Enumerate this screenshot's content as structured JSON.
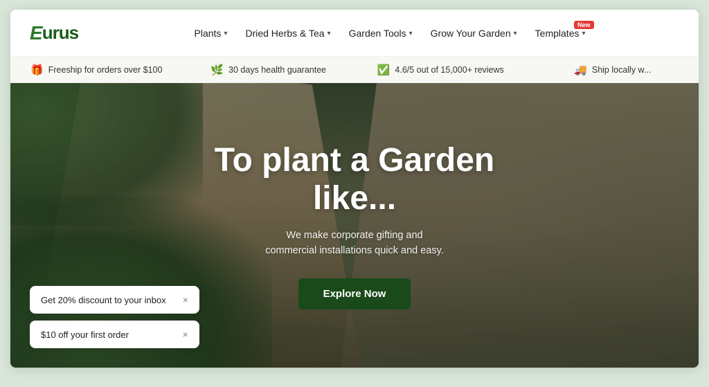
{
  "brand": {
    "name": "Eurus",
    "logo_e": "E",
    "logo_rest": "urus"
  },
  "nav": {
    "items": [
      {
        "label": "Plants",
        "has_dropdown": true
      },
      {
        "label": "Dried Herbs & Tea",
        "has_dropdown": true
      },
      {
        "label": "Garden Tools",
        "has_dropdown": true
      },
      {
        "label": "Grow Your Garden",
        "has_dropdown": true
      },
      {
        "label": "Templates",
        "has_dropdown": true,
        "badge": "New"
      }
    ]
  },
  "promo_bar": {
    "items": [
      {
        "icon": "🎁",
        "text": "Freeship for orders over $100"
      },
      {
        "icon": "🌿",
        "text": "30 days health guarantee"
      },
      {
        "icon": "✅",
        "text": "4.6/5 out of 15,000+ reviews"
      },
      {
        "icon": "🚚",
        "text": "Ship locally w..."
      }
    ]
  },
  "hero": {
    "title_line1": "To plant a Garden",
    "title_line2": "like...",
    "subtitle": "We make corporate gifting and commercial installations quick and easy.",
    "cta_label": "Explore Now"
  },
  "popups": [
    {
      "text": "Get 20% discount to your inbox",
      "close": "×"
    },
    {
      "text": "$10 off your first order",
      "close": "×"
    }
  ]
}
